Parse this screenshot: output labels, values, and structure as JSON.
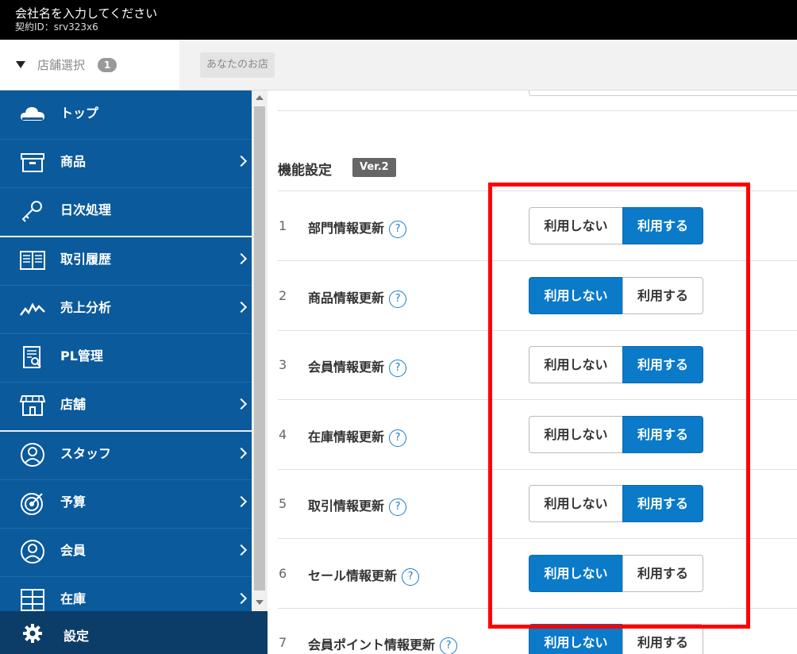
{
  "header": {
    "company_name": "会社名を入力してください",
    "contract_id": "契約ID：srv323x6"
  },
  "store_selector": {
    "label": "店舗選択",
    "count": "1",
    "current_store": "あなたのお店"
  },
  "sidebar": {
    "items": [
      {
        "label": "トップ",
        "icon": "cloud-icon",
        "has_submenu": false
      },
      {
        "label": "商品",
        "icon": "box-icon",
        "has_submenu": true
      },
      {
        "label": "日次処理",
        "icon": "key-icon",
        "has_submenu": false
      },
      {
        "label": "取引履歴",
        "icon": "book-icon",
        "has_submenu": true
      },
      {
        "label": "売上分析",
        "icon": "line-chart-icon",
        "has_submenu": true
      },
      {
        "label": "PL管理",
        "icon": "report-icon",
        "has_submenu": false
      },
      {
        "label": "店舗",
        "icon": "storefront-icon",
        "has_submenu": true
      },
      {
        "label": "スタッフ",
        "icon": "staff-icon",
        "has_submenu": true
      },
      {
        "label": "予算",
        "icon": "target-icon",
        "has_submenu": true
      },
      {
        "label": "会員",
        "icon": "member-icon",
        "has_submenu": true
      },
      {
        "label": "在庫",
        "icon": "shelf-icon",
        "has_submenu": true
      }
    ],
    "settings_label": "設定"
  },
  "main": {
    "section_title": "機能設定",
    "version_badge": "Ver.2",
    "help_glyph": "?",
    "option_off_label": "利用しない",
    "option_on_label": "利用する",
    "settings": [
      {
        "no": "1",
        "name": "部門情報更新",
        "selected": "on"
      },
      {
        "no": "2",
        "name": "商品情報更新",
        "selected": "off"
      },
      {
        "no": "3",
        "name": "会員情報更新",
        "selected": "on"
      },
      {
        "no": "4",
        "name": "在庫情報更新",
        "selected": "on"
      },
      {
        "no": "5",
        "name": "取引情報更新",
        "selected": "on"
      },
      {
        "no": "6",
        "name": "セール情報更新",
        "selected": "off"
      },
      {
        "no": "7",
        "name": "会員ポイント情報更新",
        "selected": "off"
      }
    ]
  },
  "colors": {
    "sidebar_bg": "#0a5a9c",
    "settings_bar_bg": "#0c3d68",
    "accent": "#0a7ac9",
    "highlight": "#ff0000"
  }
}
